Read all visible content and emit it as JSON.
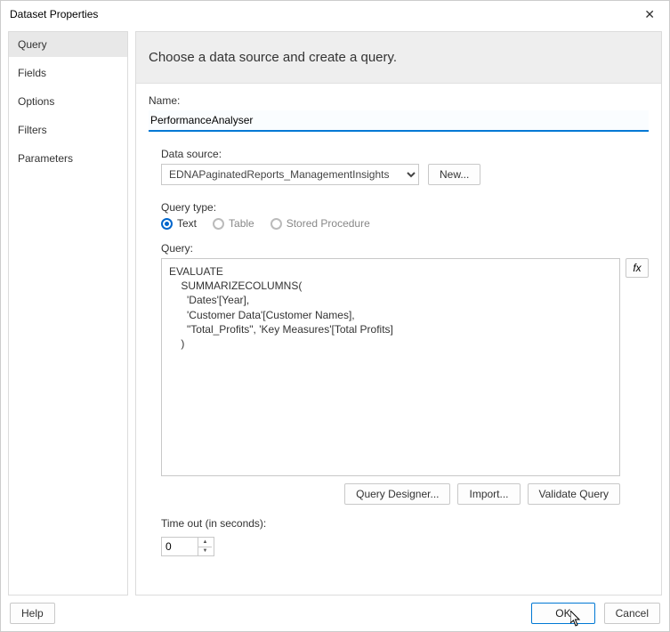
{
  "titlebar": {
    "title": "Dataset Properties"
  },
  "sidebar": {
    "items": [
      {
        "label": "Query",
        "active": true
      },
      {
        "label": "Fields",
        "active": false
      },
      {
        "label": "Options",
        "active": false
      },
      {
        "label": "Filters",
        "active": false
      },
      {
        "label": "Parameters",
        "active": false
      }
    ]
  },
  "main": {
    "header": "Choose a data source and create a query.",
    "name_label": "Name:",
    "name_value": "PerformanceAnalyser",
    "datasource_label": "Data source:",
    "datasource_value": "EDNAPaginatedReports_ManagementInsights",
    "new_button": "New...",
    "querytype_label": "Query type:",
    "querytype_options": [
      "Text",
      "Table",
      "Stored Procedure"
    ],
    "query_label": "Query:",
    "query_text": "EVALUATE\n    SUMMARIZECOLUMNS(\n      'Dates'[Year],\n      'Customer Data'[Customer Names],\n      \"Total_Profits\", 'Key Measures'[Total Profits]\n    )",
    "fx_label": "fx",
    "query_designer": "Query Designer...",
    "import": "Import...",
    "validate": "Validate Query",
    "timeout_label": "Time out (in seconds):",
    "timeout_value": "0"
  },
  "footer": {
    "help": "Help",
    "ok": "OK",
    "cancel": "Cancel"
  }
}
